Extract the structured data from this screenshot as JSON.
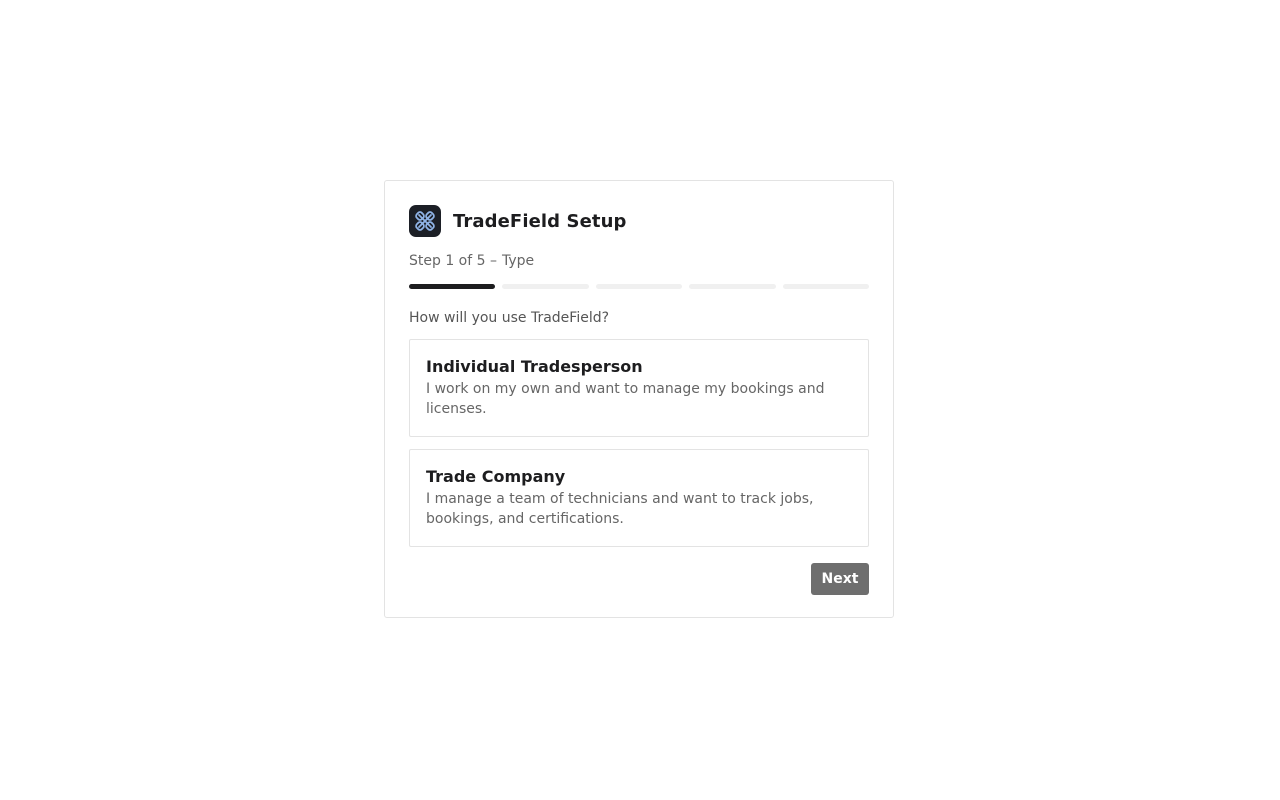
{
  "app": {
    "title": "TradeField Setup",
    "logo_icon": "tradefield-logo-icon"
  },
  "step": {
    "text": "Step 1 of 5 –",
    "name": "Type",
    "current": 1,
    "total": 5
  },
  "question": "How will you use TradeField?",
  "options": [
    {
      "title": "Individual Tradesperson",
      "description": "I work on my own and want to manage my bookings and licenses."
    },
    {
      "title": "Trade Company",
      "description": "I manage a team of technicians and want to track jobs, bookings, and certifications."
    }
  ],
  "actions": {
    "next_label": "Next"
  },
  "colors": {
    "progress_active": "#1d1d1f",
    "progress_inactive": "#f0f0f0",
    "next_button": "#6e6e6e",
    "logo_bg": "#1c1f26",
    "logo_accent": "#8fb3e6"
  }
}
